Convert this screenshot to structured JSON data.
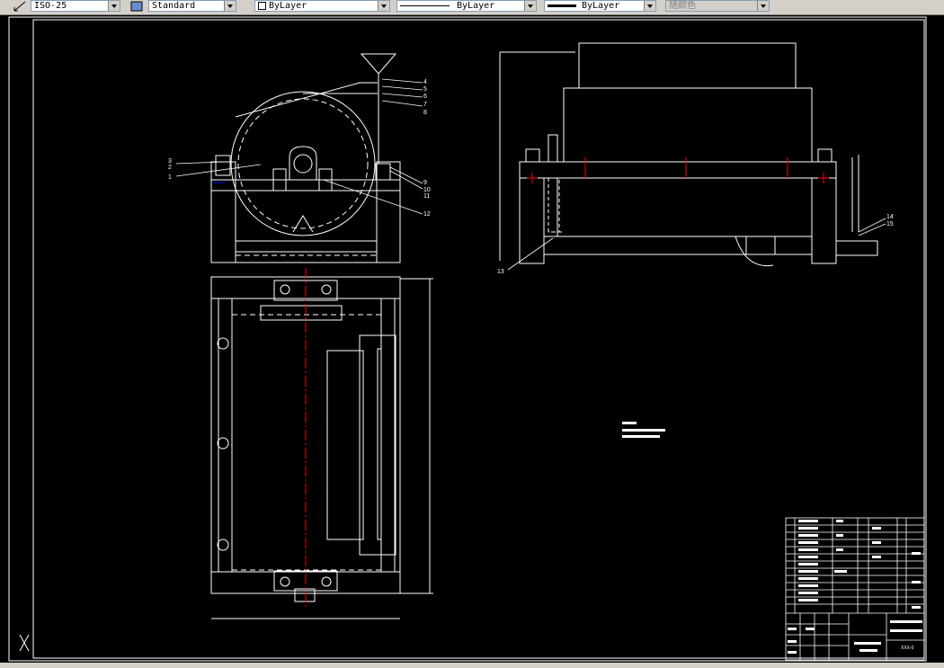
{
  "toolbar": {
    "dimstyle_value": "ISO-25",
    "textstyle_value": "Standard",
    "layer_value": "ByLayer",
    "linetype_value": "ByLayer",
    "lineweight_value": "ByLayer",
    "color_value": "随颜色"
  },
  "drawing": {
    "side_view_callouts": [
      "4",
      "5",
      "6",
      "7",
      "8",
      "9",
      "10",
      "11",
      "12",
      "3",
      "2",
      "1"
    ],
    "front_view_callouts": [
      "13",
      "14",
      "15"
    ],
    "title_block_drawing_no": "XXX-0"
  },
  "colors": {
    "background": "#000000",
    "lines": "#ffffff",
    "centerline": "#ff0000",
    "accent": "#0000ff"
  }
}
